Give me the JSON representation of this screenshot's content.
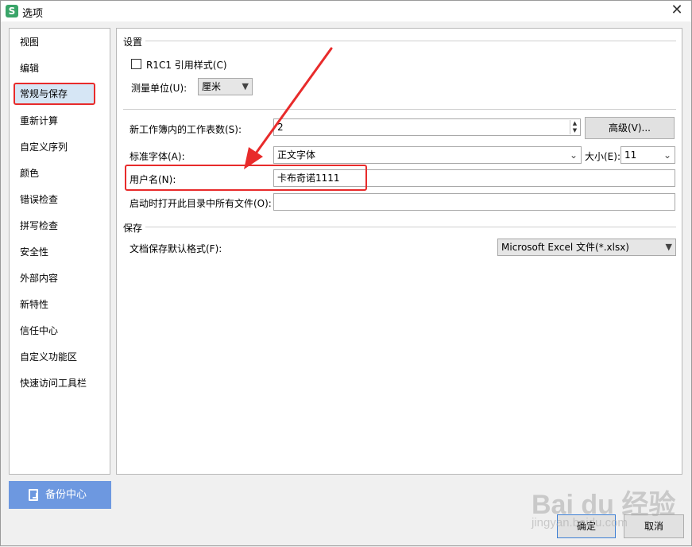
{
  "window": {
    "title": "选项",
    "app_icon_letter": "S"
  },
  "sidebar": {
    "items": [
      {
        "label": "视图"
      },
      {
        "label": "编辑"
      },
      {
        "label": "常规与保存"
      },
      {
        "label": "重新计算"
      },
      {
        "label": "自定义序列"
      },
      {
        "label": "颜色"
      },
      {
        "label": "错误检查"
      },
      {
        "label": "拼写检查"
      },
      {
        "label": "安全性"
      },
      {
        "label": "外部内容"
      },
      {
        "label": "新特性"
      },
      {
        "label": "信任中心"
      },
      {
        "label": "自定义功能区"
      },
      {
        "label": "快速访问工具栏"
      }
    ],
    "selected": "常规与保存",
    "backup_label": "备份中心"
  },
  "settings": {
    "section_title": "设置",
    "r1c1_label": "R1C1 引用样式(C)",
    "r1c1_checked": false,
    "unit_label": "测量单位(U):",
    "unit_value": "厘米",
    "sheets_label": "新工作簿内的工作表数(S):",
    "sheets_value": "2",
    "advanced_button": "高级(V)...",
    "font_label": "标准字体(A):",
    "font_value": "正文字体",
    "size_label": "大小(E):",
    "size_value": "11",
    "username_label": "用户名(N):",
    "username_value": "卡布奇诺1111",
    "startup_label": "启动时打开此目录中所有文件(O):",
    "startup_value": ""
  },
  "save": {
    "section_title": "保存",
    "format_label": "文档保存默认格式(F):",
    "format_value": "Microsoft Excel 文件(*.xlsx)"
  },
  "footer": {
    "ok_label": "确定",
    "cancel_label": "取消"
  },
  "watermark": {
    "text": "Bai du 经验",
    "url_text": "jingyan.baidu.com"
  },
  "colors": {
    "highlight": "#e82b2b",
    "backup_bg": "#6d98e0",
    "selected_bg": "#d6e6f5"
  }
}
